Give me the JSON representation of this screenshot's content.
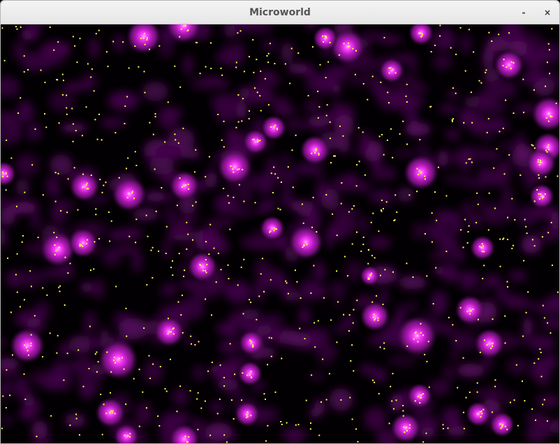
{
  "window": {
    "title": "Microworld",
    "minimize_glyph": "-",
    "close_glyph": "×"
  },
  "colors": {
    "background": "#030003",
    "haze": "#3c0644",
    "haze_mid": "#5a0a62",
    "glow_outer": "#7a1480",
    "glow_mid": "#b019b8",
    "glow_core": "#ff3cff",
    "particle": "#ffff55"
  }
}
